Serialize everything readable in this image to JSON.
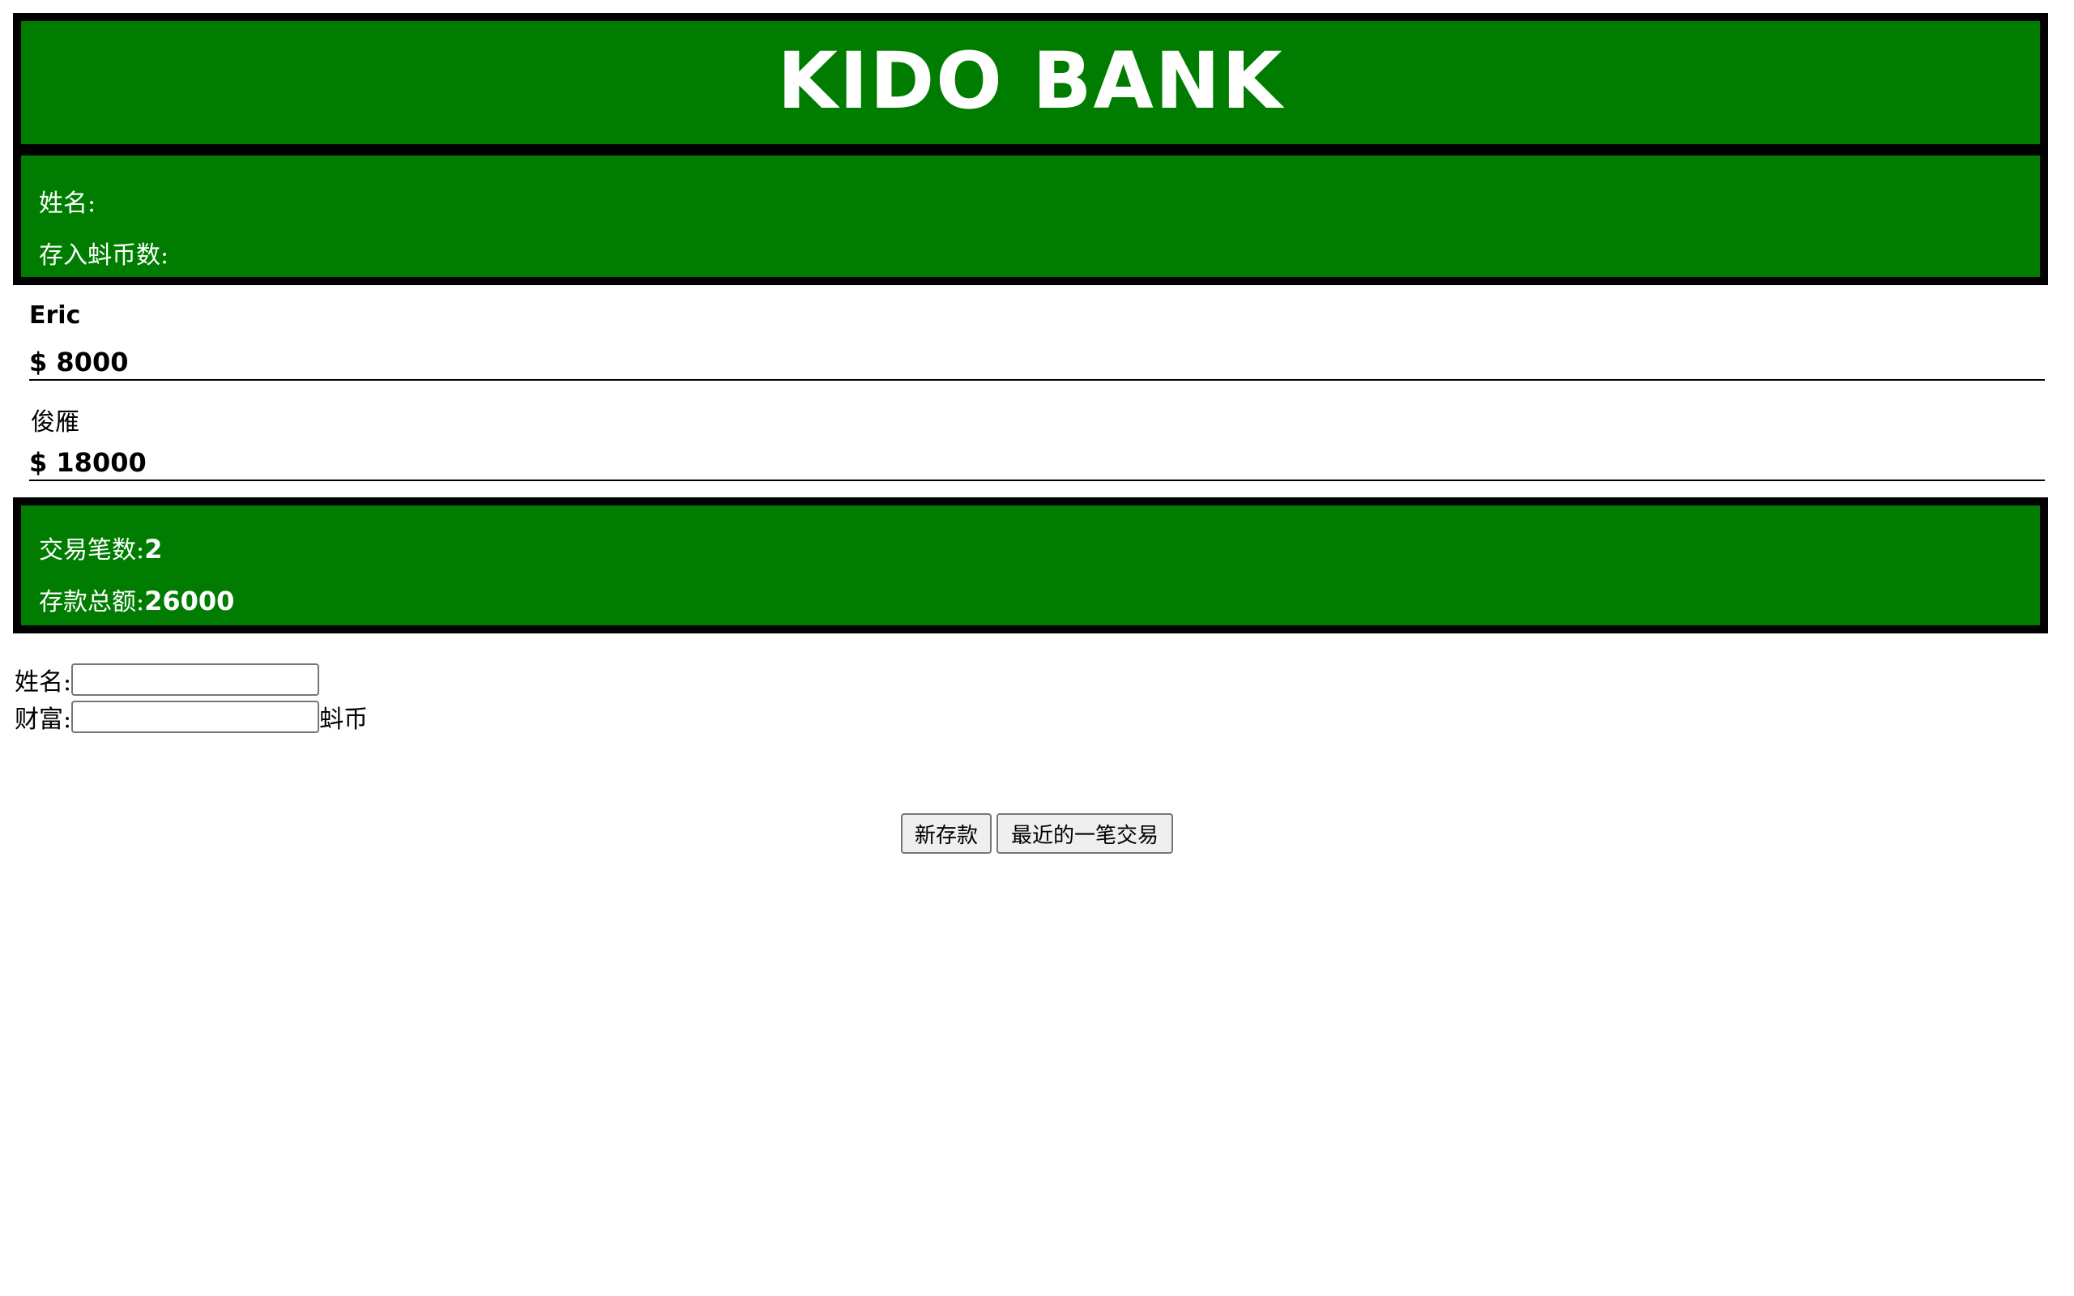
{
  "header": {
    "title": "KIDO BANK"
  },
  "labels": {
    "name_label": "姓名:",
    "deposit_label": "存入蚪币数:"
  },
  "entries": [
    {
      "name": "Eric",
      "amount": "$ 8000"
    },
    {
      "name": "俊雁",
      "amount": "$ 18000"
    }
  ],
  "summary": {
    "count_label": "交易笔数:",
    "count_value": "2",
    "total_label": "存款总额:",
    "total_value": "26000"
  },
  "form": {
    "name_label": "姓名:",
    "name_value": "",
    "wealth_label": "财富:",
    "wealth_value": "",
    "unit": "蚪币"
  },
  "buttons": {
    "new_deposit": "新存款",
    "latest_transaction": "最近的一笔交易"
  },
  "colors": {
    "panel_bg": "#007d00",
    "panel_border": "#000000",
    "panel_text": "#ffffff"
  }
}
